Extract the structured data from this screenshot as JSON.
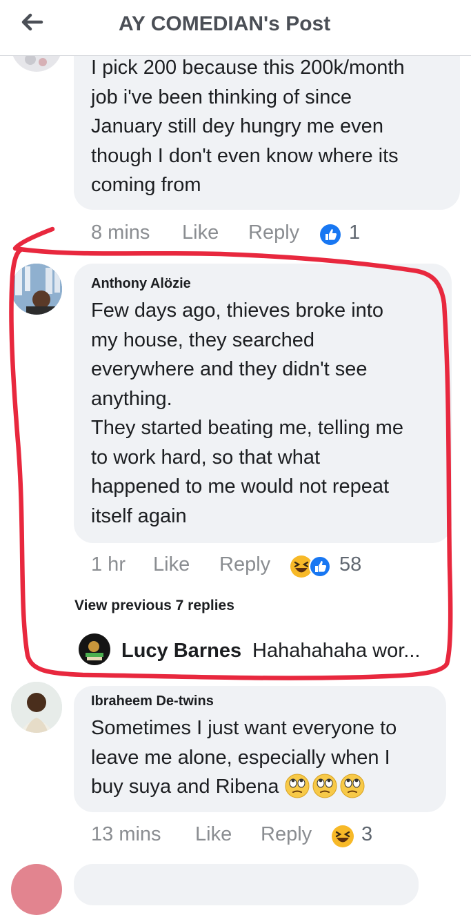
{
  "header": {
    "title": "AY COMEDIAN's Post"
  },
  "comments": [
    {
      "text": "I pick 200 because this 200k/month\njob i've been thinking of since\nJanuary still dey hungry me even\nthough I don't even know where its\ncoming from",
      "time": "8 mins",
      "like": "Like",
      "reply": "Reply",
      "reactions": [
        "like"
      ],
      "count": "1"
    },
    {
      "author": "Anthony Alözie",
      "text": "Few days ago, thieves broke into\nmy house,  they searched\neverywhere and they didn't see\nanything.\nThey started beating me, telling me\nto work hard, so that what\nhappened to me would not repeat\nitself again",
      "time": "1 hr",
      "like": "Like",
      "reply": "Reply",
      "reactions": [
        "haha",
        "like"
      ],
      "count": "58",
      "view_previous": "View previous 7 replies",
      "latest_reply": {
        "author": "Lucy Barnes",
        "snippet": "Hahahahaha wor..."
      }
    },
    {
      "author": "Ibraheem De-twins",
      "text": "Sometimes I just want everyone to\nleave me alone, especially when I\nbuy suya and Ribena",
      "emojis": [
        "eye-roll-face",
        "eye-roll-face",
        "eye-roll-face"
      ],
      "time": "13 mins",
      "like": "Like",
      "reply": "Reply",
      "reactions": [
        "haha"
      ],
      "count": "3"
    }
  ],
  "colors": {
    "highlight": "#e8283e",
    "like_blue": "#1877f2",
    "haha_yellow": "#f7b928",
    "bubble": "#f0f2f5"
  },
  "icons": [
    "back-arrow-icon",
    "like-reaction-icon",
    "haha-reaction-icon",
    "eye-roll-emoji"
  ]
}
